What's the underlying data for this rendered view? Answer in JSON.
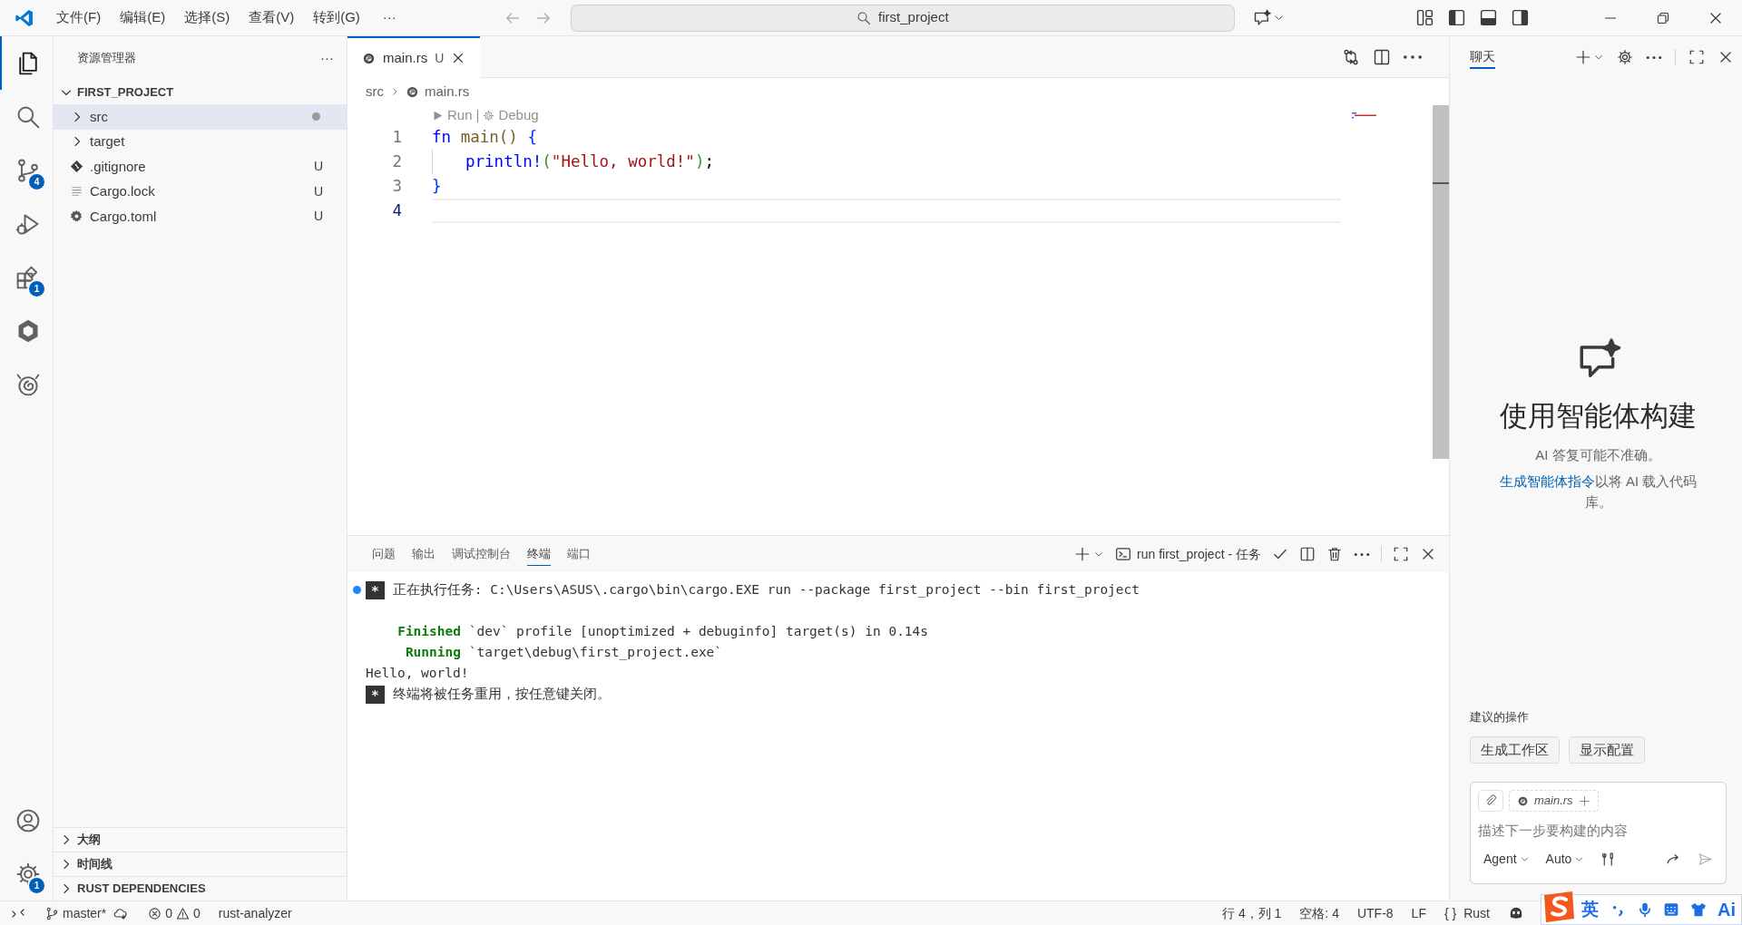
{
  "title_bar": {
    "menus": [
      "文件(F)",
      "编辑(E)",
      "选择(S)",
      "查看(V)",
      "转到(G)"
    ],
    "overflow": "···",
    "search": "first_project"
  },
  "activity_bar": {
    "items": [
      {
        "kind": "explorer",
        "selected": true
      },
      {
        "kind": "search",
        "selected": false
      },
      {
        "kind": "source-control",
        "selected": false,
        "badge": "4"
      },
      {
        "kind": "debug",
        "selected": false
      },
      {
        "kind": "extensions",
        "selected": false,
        "badge": "1"
      },
      {
        "kind": "cube",
        "selected": false
      },
      {
        "kind": "swirl",
        "selected": false
      }
    ],
    "bottom": [
      {
        "kind": "account",
        "selected": false
      },
      {
        "kind": "settings",
        "selected": false,
        "badge": "1"
      }
    ]
  },
  "sidebar": {
    "title": "资源管理器",
    "more": "···",
    "root": {
      "label": "FIRST_PROJECT",
      "expanded": true
    },
    "items": [
      {
        "label": "src",
        "kind": "folder",
        "expanded": false,
        "selected": true,
        "modified": true
      },
      {
        "label": "target",
        "kind": "folder",
        "expanded": false,
        "selected": false,
        "modified": false
      },
      {
        "label": ".gitignore",
        "kind": "git",
        "selected": false,
        "status": "U"
      },
      {
        "label": "Cargo.lock",
        "kind": "lines",
        "selected": false,
        "status": "U"
      },
      {
        "label": "Cargo.toml",
        "kind": "gear",
        "selected": false,
        "status": "U"
      }
    ],
    "sections": [
      {
        "label": "大纲",
        "expanded": false
      },
      {
        "label": "时间线",
        "expanded": false
      },
      {
        "label": "RUST DEPENDENCIES",
        "expanded": false
      }
    ]
  },
  "editor": {
    "tabs": [
      {
        "label": "main.rs",
        "status": "U",
        "selected": true
      }
    ],
    "breadcrumb": [
      "src",
      "main.rs"
    ],
    "codelens": {
      "run": "Run",
      "separator": "|",
      "debug": "Debug"
    },
    "lines": [
      {
        "number": "1",
        "current": false,
        "tokens": [
          {
            "kind": "keyword",
            "text": "fn"
          },
          {
            "kind": "function",
            "text": "main",
            "spaced": true
          },
          {
            "kind": "paren",
            "text": "()"
          },
          {
            "kind": "bracket1",
            "text": "{",
            "spaced": true
          }
        ]
      },
      {
        "number": "2",
        "current": false,
        "indented": true,
        "tokens": [
          {
            "kind": "macro",
            "text": "println!"
          },
          {
            "kind": "bracket2",
            "text": "("
          },
          {
            "kind": "string",
            "text": "\"Hello, world!\""
          },
          {
            "kind": "bracket2",
            "text": ")"
          },
          {
            "kind": "plain",
            "text": ";"
          }
        ]
      },
      {
        "number": "3",
        "current": false,
        "tokens": [
          {
            "kind": "bracket1",
            "text": "}"
          }
        ]
      },
      {
        "number": "4",
        "current": true
      }
    ]
  },
  "panel": {
    "tabs": [
      {
        "label": "问题",
        "selected": false
      },
      {
        "label": "输出",
        "selected": false
      },
      {
        "label": "调试控制台",
        "selected": false
      },
      {
        "label": "终端",
        "selected": true
      },
      {
        "label": "端口",
        "selected": false
      }
    ],
    "terminal_name": "run first_project - 任务",
    "lines": [
      {
        "kind": "task",
        "marker": "*",
        "text": "正在执行任务: C:\\Users\\ASUS\\.cargo\\bin\\cargo.EXE run --package first_project --bin first_project",
        "running": true
      },
      {
        "kind": "blank"
      },
      {
        "kind": "cargo",
        "label": "Finished",
        "text": "`dev` profile [unoptimized + debuginfo] target(s) in 0.14s"
      },
      {
        "kind": "cargo",
        "label": "Running",
        "text": "`target\\debug\\first_project.exe`"
      },
      {
        "kind": "plain",
        "text": "Hello, world!"
      },
      {
        "kind": "task",
        "marker": "*",
        "text": "终端将被任务重用，按任意键关闭。",
        "running": false
      }
    ]
  },
  "chat": {
    "tabs": [
      {
        "label": "聊天",
        "selected": true
      }
    ],
    "heading": "使用智能体构建",
    "subtitle": "AI 答复可能不准确。",
    "hint": {
      "link": "生成智能体指令",
      "text": "以将 AI 载入代码库。"
    },
    "suggestions_label": "建议的操作",
    "suggestions": [
      "生成工作区",
      "显示配置"
    ],
    "input": {
      "attachment": "main.rs",
      "placeholder": "描述下一步要构建的内容",
      "mode": "Agent",
      "model": "Auto"
    }
  },
  "status_bar": {
    "branch": "master*",
    "errors": "0",
    "warnings": "0",
    "language_server": "rust-analyzer",
    "position": "行 4，列 1",
    "indentation": "空格: 4",
    "encoding": "UTF-8",
    "line_ending": "LF",
    "language_braces": "{ }",
    "language": "Rust"
  },
  "ime_toolbar": {
    "mode": "英",
    "ai": "Ai"
  }
}
